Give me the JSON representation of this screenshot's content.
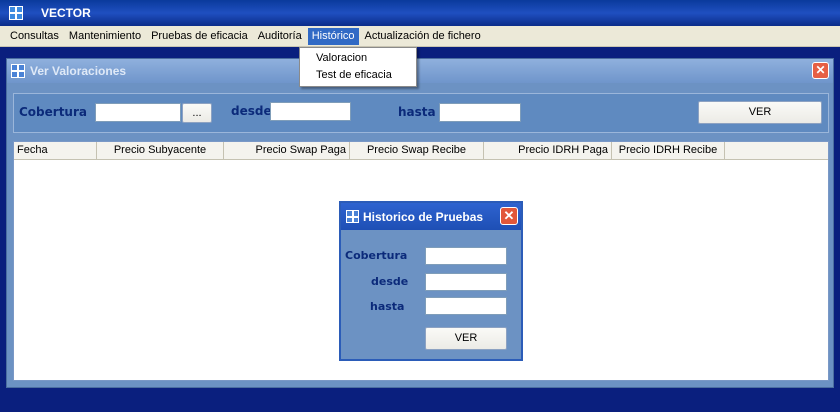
{
  "app": {
    "title": "VECTOR"
  },
  "menubar": {
    "items": [
      "Consultas",
      "Mantenimiento",
      "Pruebas de eficacia",
      "Auditoría",
      "Histórico",
      "Actualización de fichero"
    ],
    "active": "Histórico"
  },
  "dropdown": {
    "items": [
      "Valoracion",
      "Test de eficacia"
    ]
  },
  "valoraciones_window": {
    "title": "Ver Valoraciones",
    "cobertura_label": "Cobertura",
    "cobertura_value": "",
    "browse_label": "...",
    "desde_label": "desde",
    "desde_value": "",
    "hasta_label": "hasta",
    "hasta_value": "",
    "ver_label": "VER",
    "columns": [
      "Fecha",
      "Precio Subyacente",
      "Precio Swap Paga",
      "Precio Swap Recibe",
      "Precio IDRH Paga",
      "Precio IDRH Recibe"
    ],
    "rows": []
  },
  "historico_dialog": {
    "title": "Historico de Pruebas",
    "cobertura_label": "Cobertura",
    "desde_label": "desde",
    "hasta_label": "hasta",
    "cobertura_value": "",
    "desde_value": "",
    "hasta_value": "",
    "ver_label": "VER"
  },
  "colors": {
    "titlebar": "#0a3a9c",
    "menu_highlight": "#316ac5",
    "window_body": "#6c92c3",
    "label_text": "#0b2a7a"
  }
}
